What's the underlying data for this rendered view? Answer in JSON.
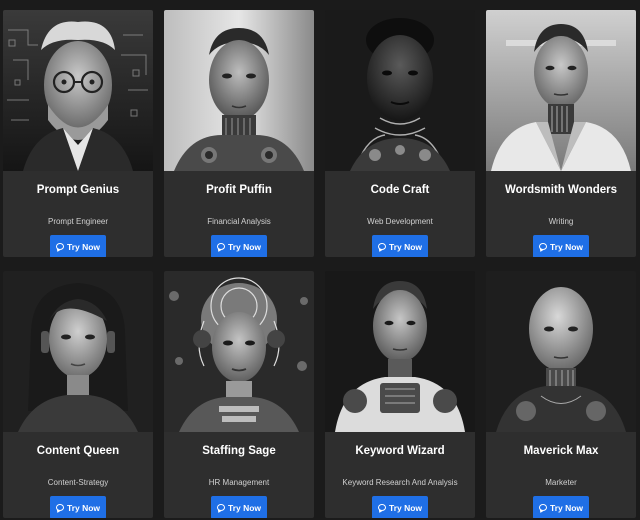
{
  "cards": [
    {
      "name": "Prompt Genius",
      "role": "Prompt Engineer",
      "button": "Try Now",
      "portrait": "grey-haired-man-glasses"
    },
    {
      "name": "Profit Puffin",
      "role": "Financial Analysis",
      "button": "Try Now",
      "portrait": "young-man-cyborg"
    },
    {
      "name": "Code Craft",
      "role": "Web Development",
      "button": "Try Now",
      "portrait": "dark-skinned-man-cyborg"
    },
    {
      "name": "Wordsmith Wonders",
      "role": "Writing",
      "button": "Try Now",
      "portrait": "man-in-suit-cyborg"
    },
    {
      "name": "Content Queen",
      "role": "Content-Strategy",
      "button": "Try Now",
      "portrait": "woman-headphones"
    },
    {
      "name": "Staffing Sage",
      "role": "HR Management",
      "button": "Try Now",
      "portrait": "woman-robotic-headpiece"
    },
    {
      "name": "Keyword Wizard",
      "role": "Keyword Research And Analysis",
      "button": "Try Now",
      "portrait": "man-robotic-torso"
    },
    {
      "name": "Maverick Max",
      "role": "Marketer",
      "button": "Try Now",
      "portrait": "bald-man-cyborg"
    }
  ],
  "colors": {
    "background": "#1b1b1b",
    "card": "#2e2e2e",
    "button": "#1f6fe6"
  },
  "icons": {
    "button": "chat-bubble-icon"
  }
}
